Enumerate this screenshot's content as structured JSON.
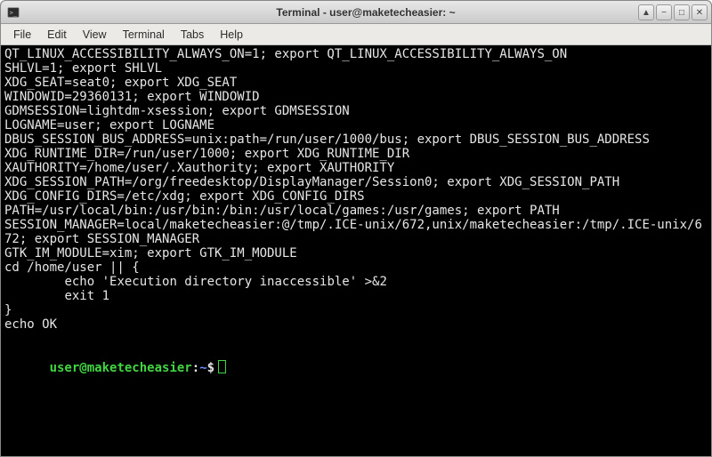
{
  "window": {
    "title": "Terminal - user@maketecheasier: ~"
  },
  "menubar": {
    "items": [
      "File",
      "Edit",
      "View",
      "Terminal",
      "Tabs",
      "Help"
    ]
  },
  "controls": {
    "up": "▲",
    "min": "−",
    "max": "□",
    "close": "✕"
  },
  "terminal": {
    "lines": [
      "QT_LINUX_ACCESSIBILITY_ALWAYS_ON=1; export QT_LINUX_ACCESSIBILITY_ALWAYS_ON",
      "SHLVL=1; export SHLVL",
      "XDG_SEAT=seat0; export XDG_SEAT",
      "WINDOWID=29360131; export WINDOWID",
      "GDMSESSION=lightdm-xsession; export GDMSESSION",
      "LOGNAME=user; export LOGNAME",
      "DBUS_SESSION_BUS_ADDRESS=unix:path=/run/user/1000/bus; export DBUS_SESSION_BUS_ADDRESS",
      "XDG_RUNTIME_DIR=/run/user/1000; export XDG_RUNTIME_DIR",
      "XAUTHORITY=/home/user/.Xauthority; export XAUTHORITY",
      "XDG_SESSION_PATH=/org/freedesktop/DisplayManager/Session0; export XDG_SESSION_PATH",
      "XDG_CONFIG_DIRS=/etc/xdg; export XDG_CONFIG_DIRS",
      "PATH=/usr/local/bin:/usr/bin:/bin:/usr/local/games:/usr/games; export PATH",
      "SESSION_MANAGER=local/maketecheasier:@/tmp/.ICE-unix/672,unix/maketecheasier:/tmp/.ICE-unix/672; export SESSION_MANAGER",
      "GTK_IM_MODULE=xim; export GTK_IM_MODULE",
      "cd /home/user || {",
      "        echo 'Execution directory inaccessible' >&2",
      "        exit 1",
      "}",
      "echo OK",
      ""
    ],
    "prompt": {
      "user": "user",
      "at": "@",
      "host": "maketecheasier",
      "colon": ":",
      "path": "~",
      "dollar": "$"
    }
  }
}
